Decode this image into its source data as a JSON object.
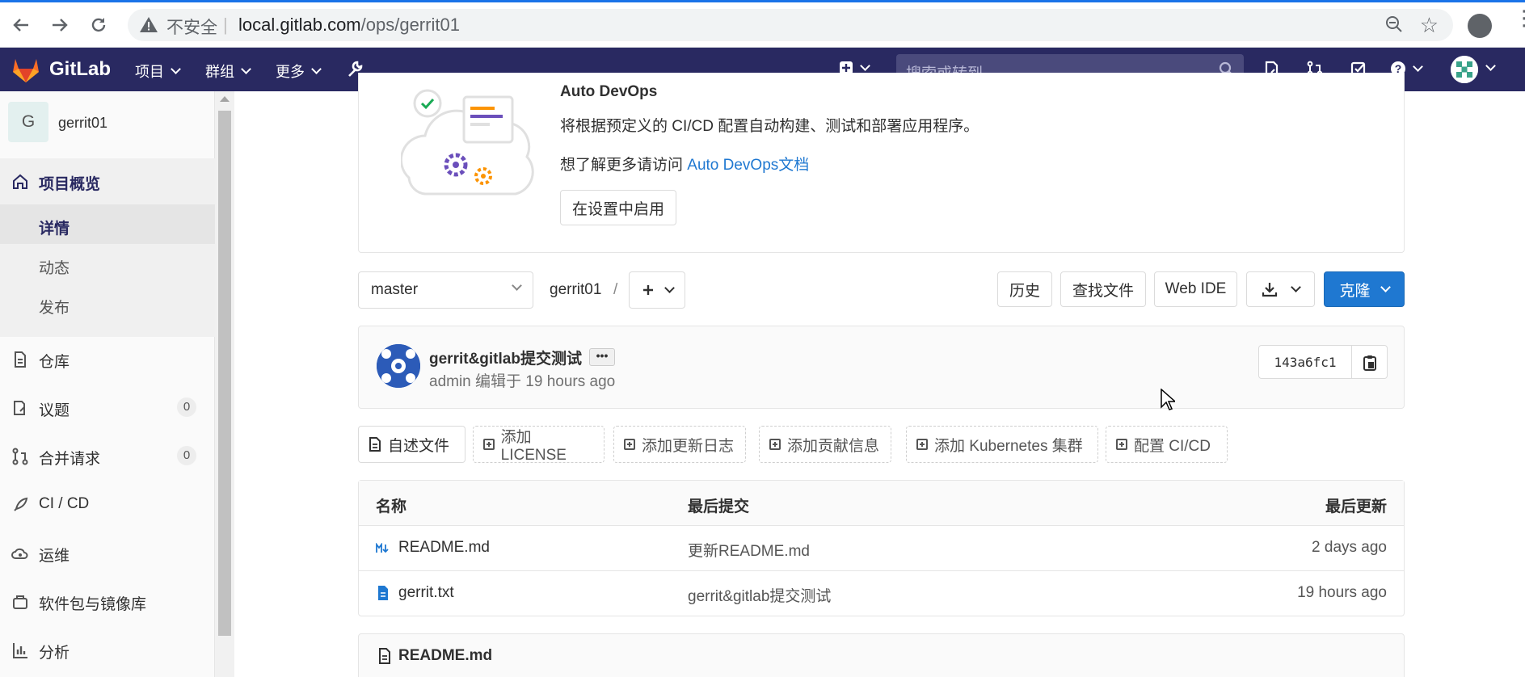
{
  "browser": {
    "insecure_label": "不安全",
    "url_host": "local.gitlab.com",
    "url_path": "/ops/gerrit01"
  },
  "header": {
    "brand": "GitLab",
    "nav": [
      "项目",
      "群组",
      "更多"
    ],
    "search_placeholder": "搜索或转到...",
    "bg_color": "#292961"
  },
  "sidebar": {
    "project_initial": "G",
    "project_name": "gerrit01",
    "overview_label": "项目概览",
    "overview_sub": [
      "详情",
      "动态",
      "发布"
    ],
    "items": [
      {
        "label": "仓库",
        "icon": "doc-icon"
      },
      {
        "label": "议题",
        "icon": "issues-icon",
        "badge": "0"
      },
      {
        "label": "合并请求",
        "icon": "merge-request-icon",
        "badge": "0"
      },
      {
        "label": "CI / CD",
        "icon": "rocket-icon"
      },
      {
        "label": "运维",
        "icon": "cloud-gear-icon"
      },
      {
        "label": "软件包与镜像库",
        "icon": "package-icon"
      },
      {
        "label": "分析",
        "icon": "chart-icon"
      }
    ]
  },
  "devops": {
    "title": "Auto DevOps",
    "description": "将根据预定义的 CI/CD 配置自动构建、测试和部署应用程序。",
    "more_prefix": "想了解更多请访问 ",
    "more_link": "Auto DevOps文档",
    "enable_button": "在设置中启用"
  },
  "repo_bar": {
    "branch": "master",
    "project_crumb": "gerrit01",
    "slash": "/",
    "history": "历史",
    "find_file": "查找文件",
    "web_ide": "Web IDE",
    "clone": "克隆",
    "clone_color": "#1f78d1"
  },
  "commit": {
    "title": "gerrit&gitlab提交测试",
    "ellipsis": "•••",
    "meta": "admin 编辑于 19 hours ago",
    "sha": "143a6fc1"
  },
  "pills": {
    "readme": "自述文件",
    "license": "添加LICENSE",
    "changelog": "添加更新日志",
    "contrib": "添加贡献信息",
    "k8s": "添加 Kubernetes 集群",
    "cicd": "配置 CI/CD"
  },
  "files": {
    "headers": {
      "name": "名称",
      "last_commit": "最后提交",
      "last_update": "最后更新"
    },
    "rows": [
      {
        "name": "README.md",
        "commit": "更新README.md",
        "updated": "2 days ago",
        "icon": "markdown-icon"
      },
      {
        "name": "gerrit.txt",
        "commit": "gerrit&gitlab提交测试",
        "updated": "19 hours ago",
        "icon": "text-file-icon"
      }
    ]
  },
  "readme_panel": {
    "title": "README.md"
  }
}
